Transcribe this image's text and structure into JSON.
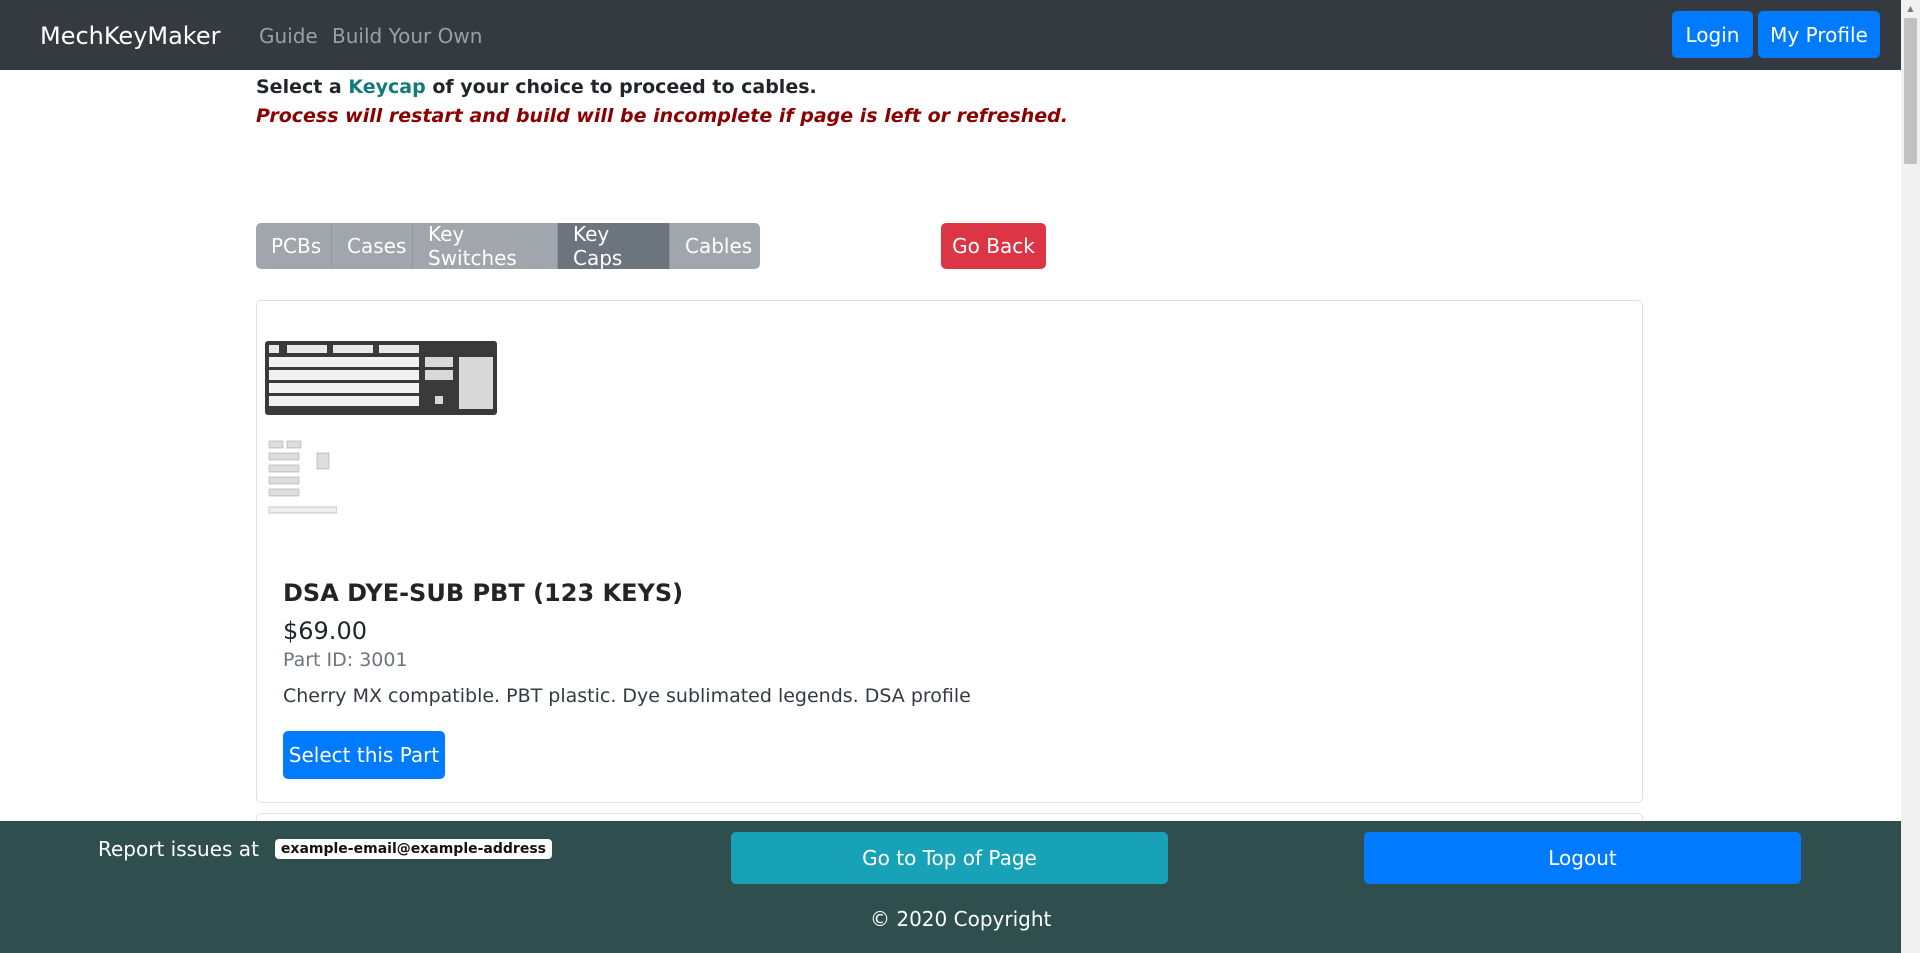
{
  "navbar": {
    "brand": "MechKeyMaker",
    "links": [
      "Guide",
      "Build Your Own"
    ],
    "login_label": "Login",
    "profile_label": "My Profile"
  },
  "intro": {
    "prefix": "Select a ",
    "keyword": "Keycap",
    "suffix": " of your choice to proceed to cables.",
    "warning": "Process will restart and build will be incomplete if page is left or refreshed."
  },
  "steps": {
    "items": [
      "PCBs",
      "Cases",
      "Key Switches",
      "Key Caps",
      "Cables"
    ],
    "active": "Key Caps",
    "go_back_label": "Go Back"
  },
  "product": {
    "name": "DSA DYE-SUB PBT (123 KEYS)",
    "price": "$69.00",
    "part_id": "Part ID: 3001",
    "description": "Cherry MX compatible. PBT plastic. Dye sublimated legends. DSA profile",
    "select_label": "Select this Part"
  },
  "footer": {
    "report_label": "Report issues at",
    "email": "example-email@example-address",
    "top_label": "Go to Top of Page",
    "logout_label": "Logout",
    "copyright": "© 2020 Copyright"
  },
  "colors": {
    "navbar": "#343a40",
    "primary": "#007bff",
    "danger": "#dc3545",
    "info": "#17a2b8",
    "footer": "#2f4f4f",
    "secondary": "#6c757d",
    "warning_text": "#8b0000",
    "keyword": "#117a7a"
  }
}
